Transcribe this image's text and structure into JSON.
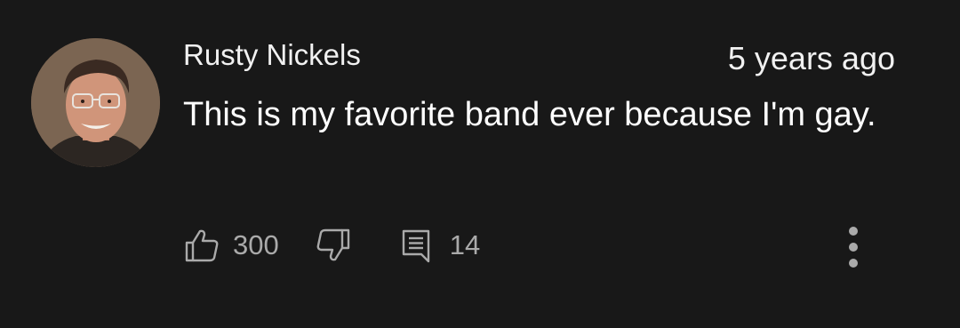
{
  "comment": {
    "author": "Rusty Nickels",
    "timestamp": "5 years ago",
    "text": "This is my favorite band ever because I'm gay.",
    "avatar_icon": "user-avatar-photo"
  },
  "actions": {
    "like_icon": "thumbs-up-icon",
    "like_count": "300",
    "dislike_icon": "thumbs-down-icon",
    "reply_icon": "comment-reply-icon",
    "reply_count": "14",
    "more_icon": "more-vertical-icon"
  },
  "colors": {
    "background": "#181818",
    "primary_text": "#ffffff",
    "secondary_text": "#aaaaaa",
    "icon": "#aaaaaa"
  }
}
